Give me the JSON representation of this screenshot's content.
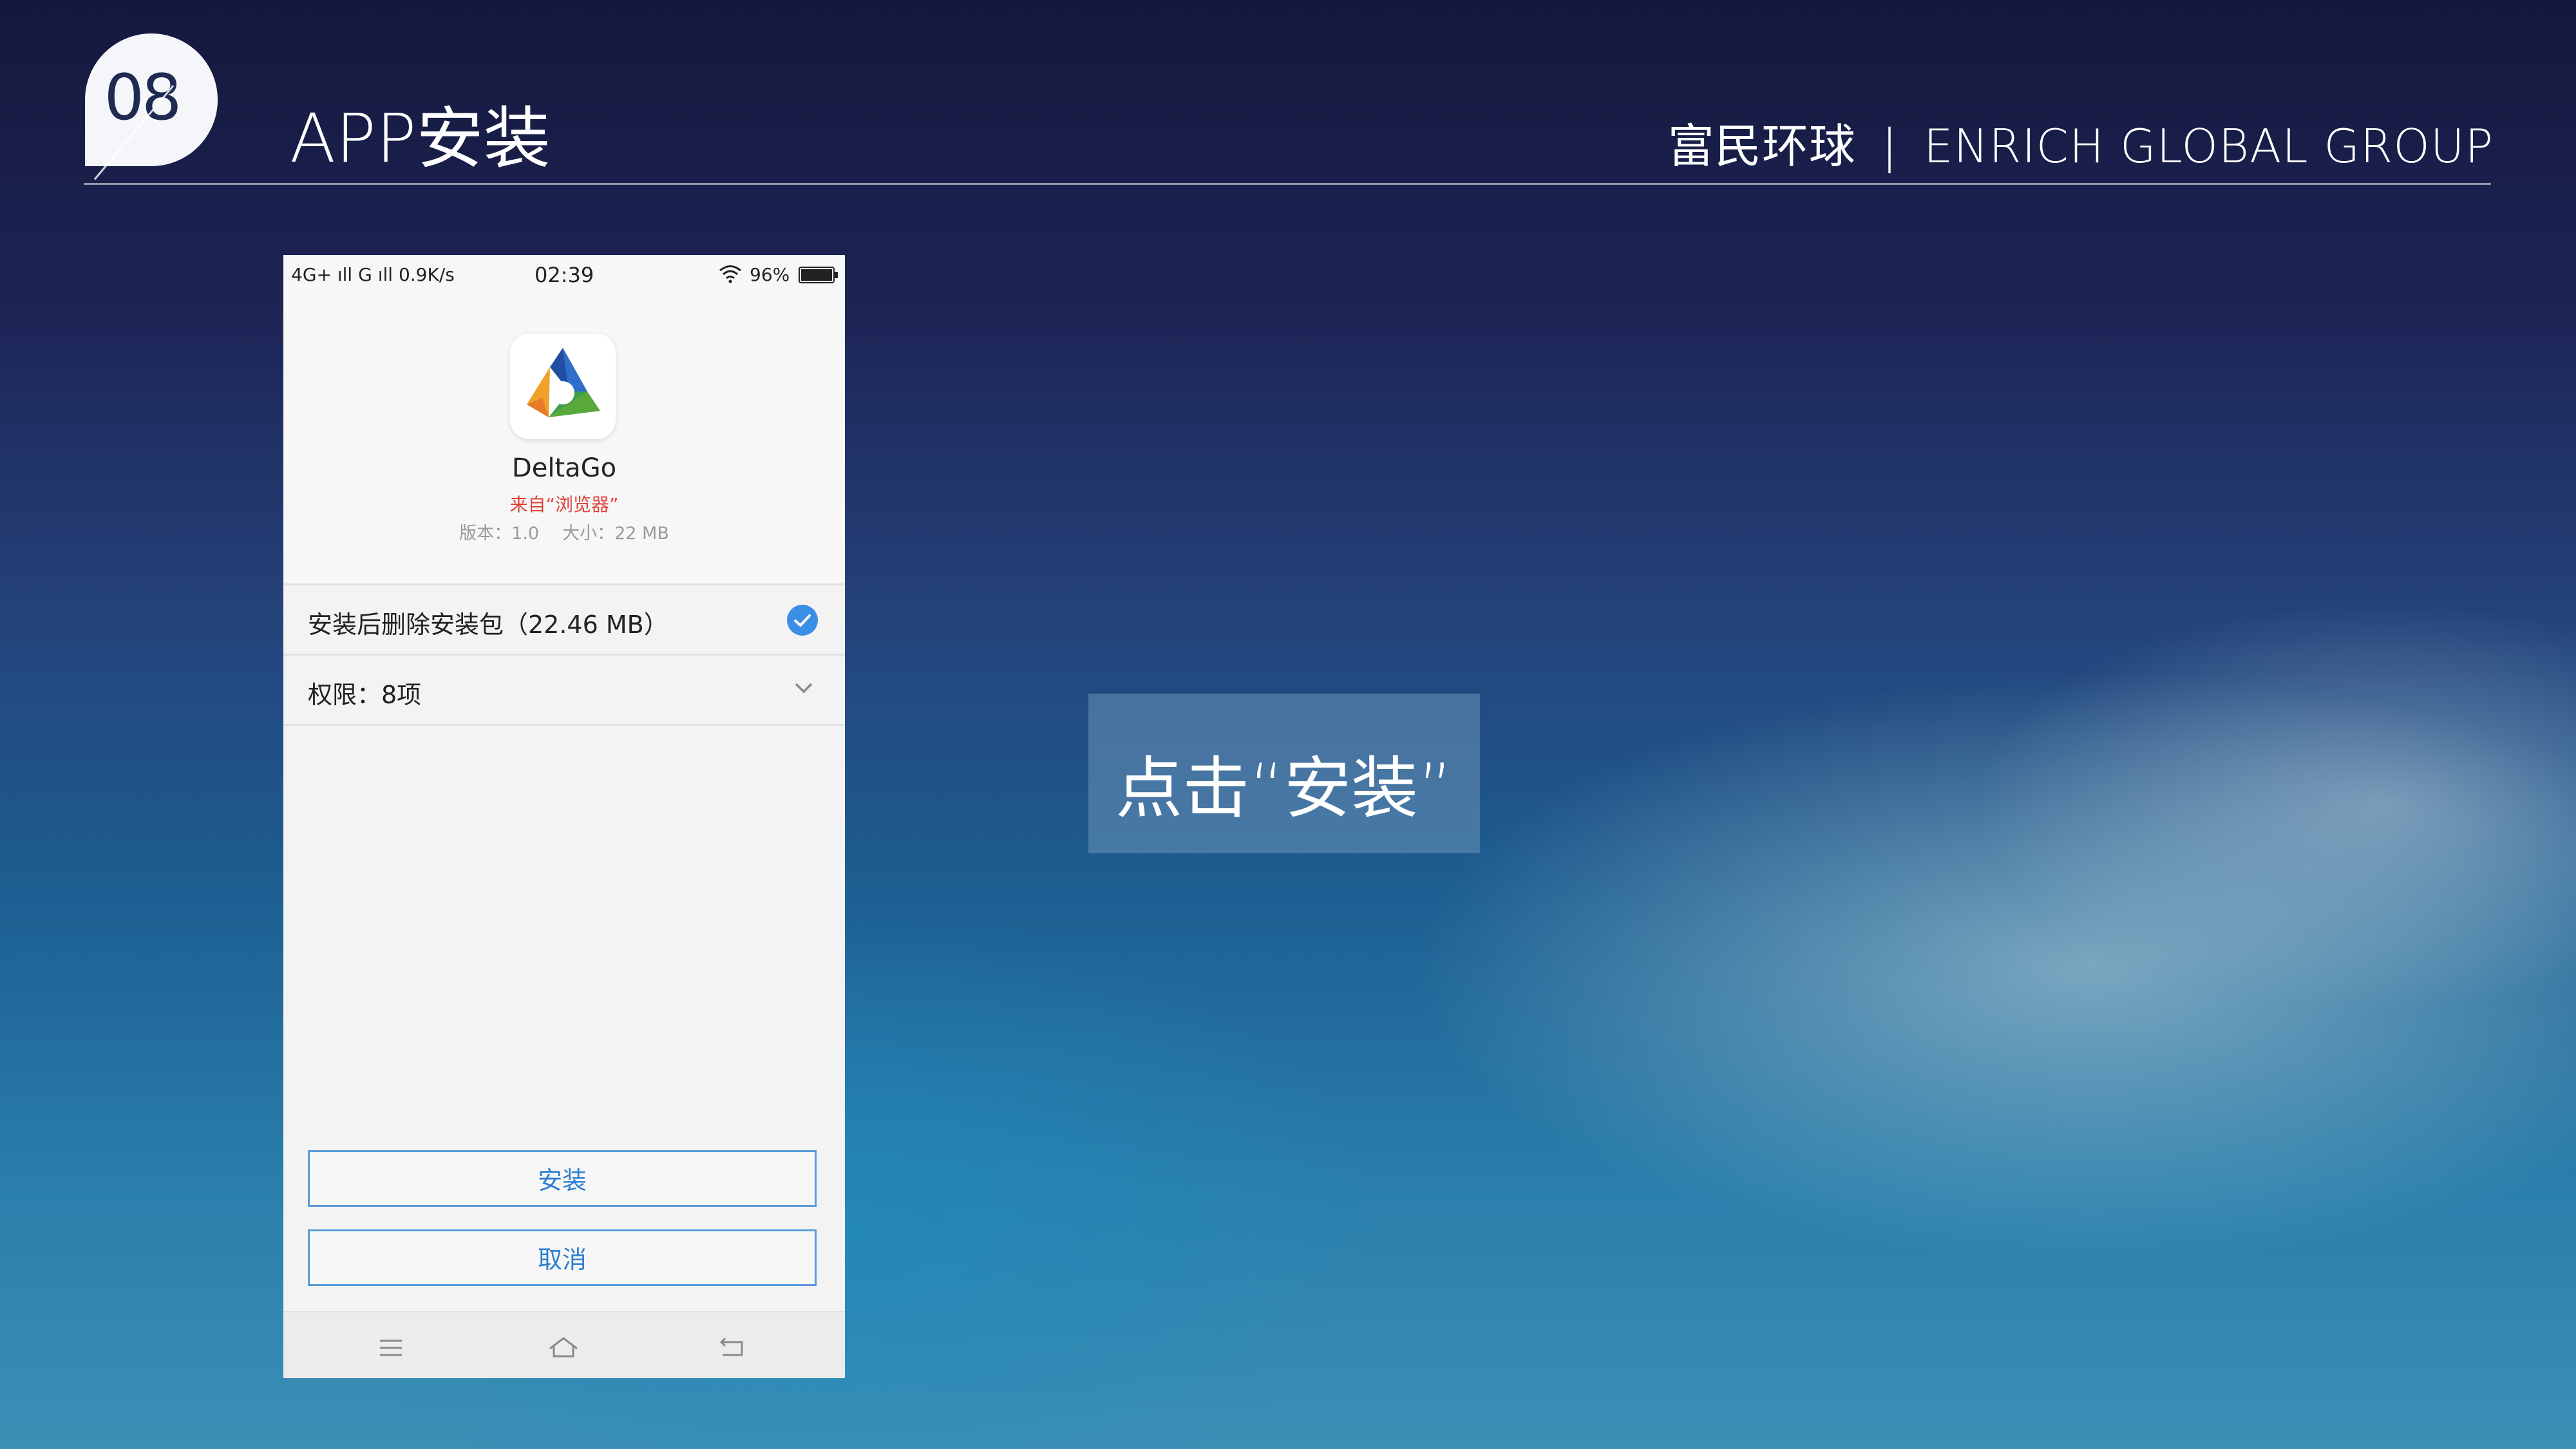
{
  "slide": {
    "number": "08",
    "title": "APP安装",
    "brand_cn": "富民环球",
    "brand_sep": "|",
    "brand_en": "ENRICH GLOBAL GROUP"
  },
  "phone": {
    "status_bar": {
      "left": "4G+ ıll G ıll 0.9K/s",
      "time": "02:39",
      "battery": "96%"
    },
    "app": {
      "name": "DeltaGo",
      "source": "来自“浏览器”",
      "version": "版本：1.0",
      "size": "大小：22 MB"
    },
    "options": {
      "delete_after_install": "安装后删除安装包（22.46 MB）",
      "permissions": "权限：8项"
    },
    "buttons": {
      "install": "安装",
      "cancel": "取消"
    }
  },
  "callout": {
    "text": "点击“安装”"
  },
  "colors": {
    "accent_blue": "#3b8ee6",
    "source_red": "#e0413a"
  }
}
